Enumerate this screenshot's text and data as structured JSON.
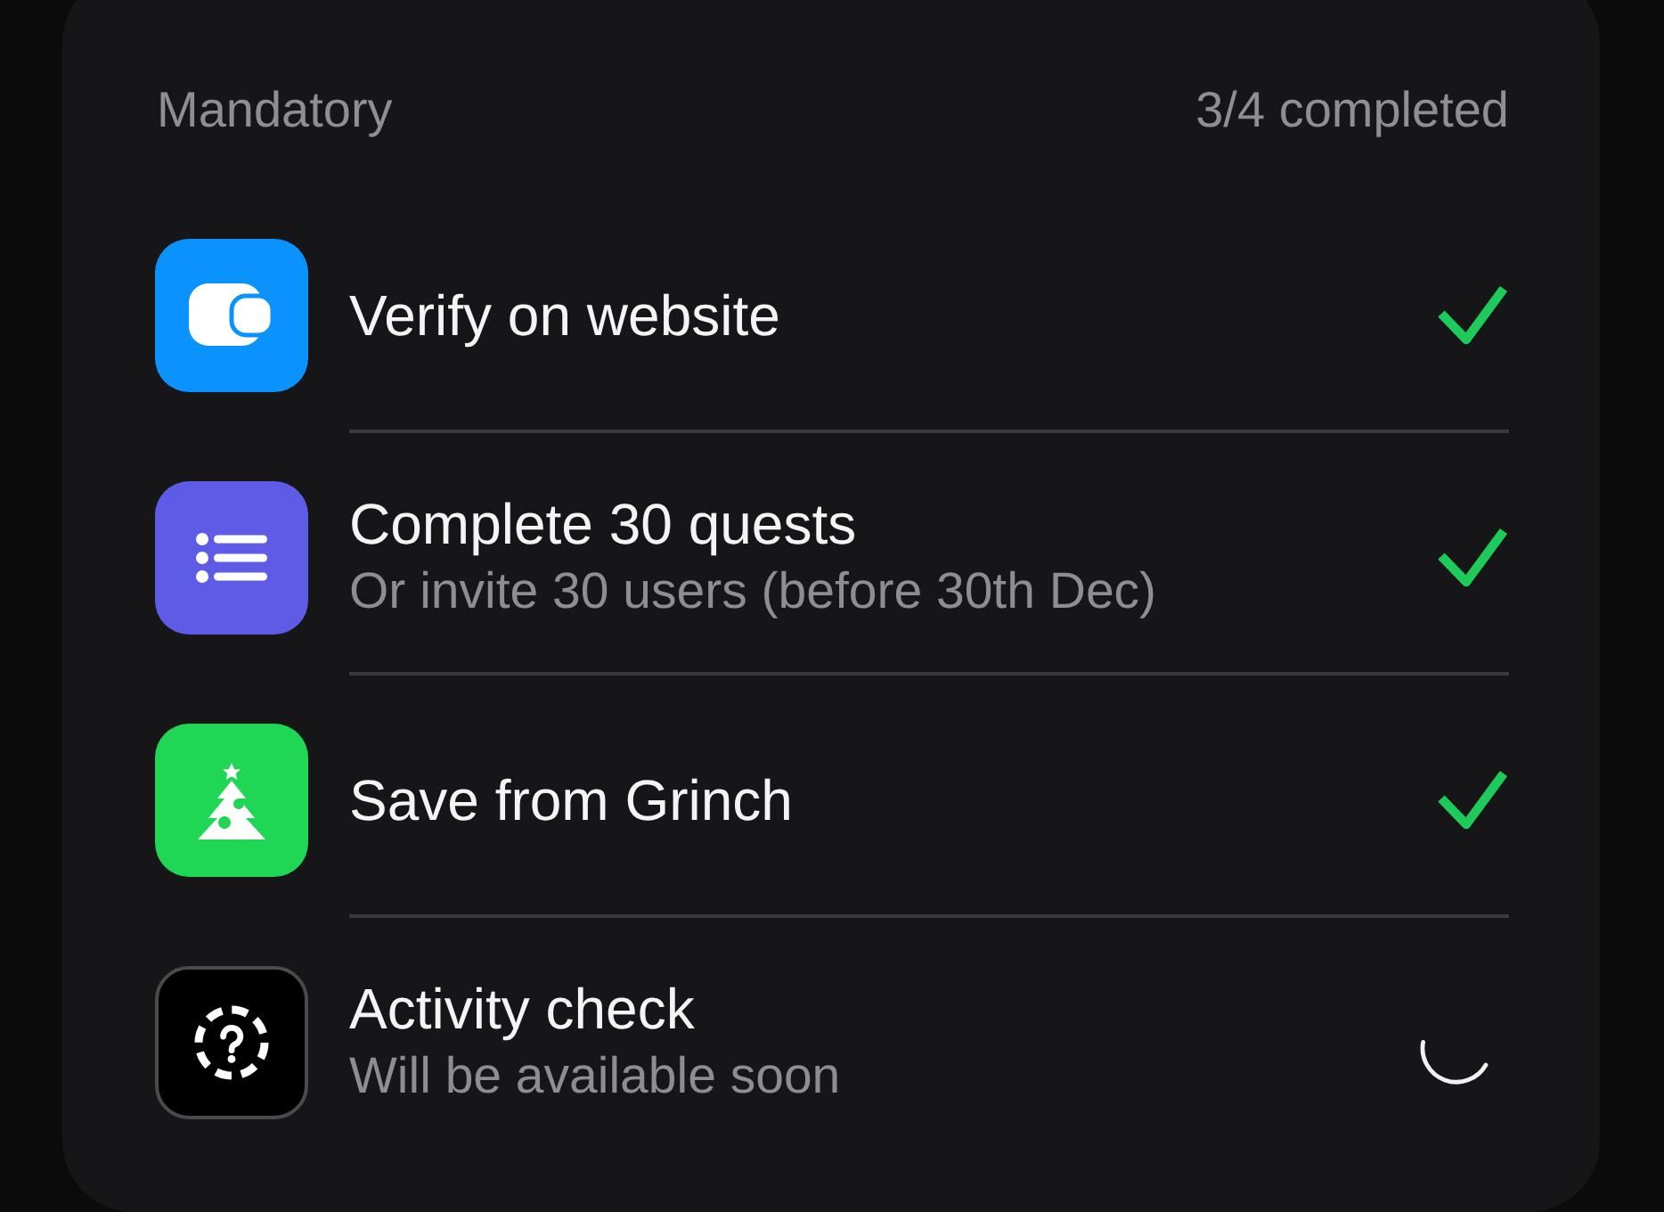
{
  "section": {
    "title": "Mandatory",
    "progress": "3/4 completed"
  },
  "tasks": [
    {
      "kind": "wallet",
      "color": "#0a93ff",
      "outlined": false,
      "title": "Verify on website",
      "completed": true
    },
    {
      "kind": "list",
      "color": "#5e5ce6",
      "outlined": false,
      "title": "Complete 30 quests",
      "subtitle": "Or invite 30 users (before 30th Dec)",
      "completed": true
    },
    {
      "kind": "tree",
      "color": "#1fd655",
      "outlined": false,
      "title": "Save from Grinch",
      "completed": true
    },
    {
      "kind": "question",
      "color": "#000000",
      "outlined": true,
      "title": "Activity check",
      "subtitle": "Will be available soon",
      "completed": false
    }
  ]
}
